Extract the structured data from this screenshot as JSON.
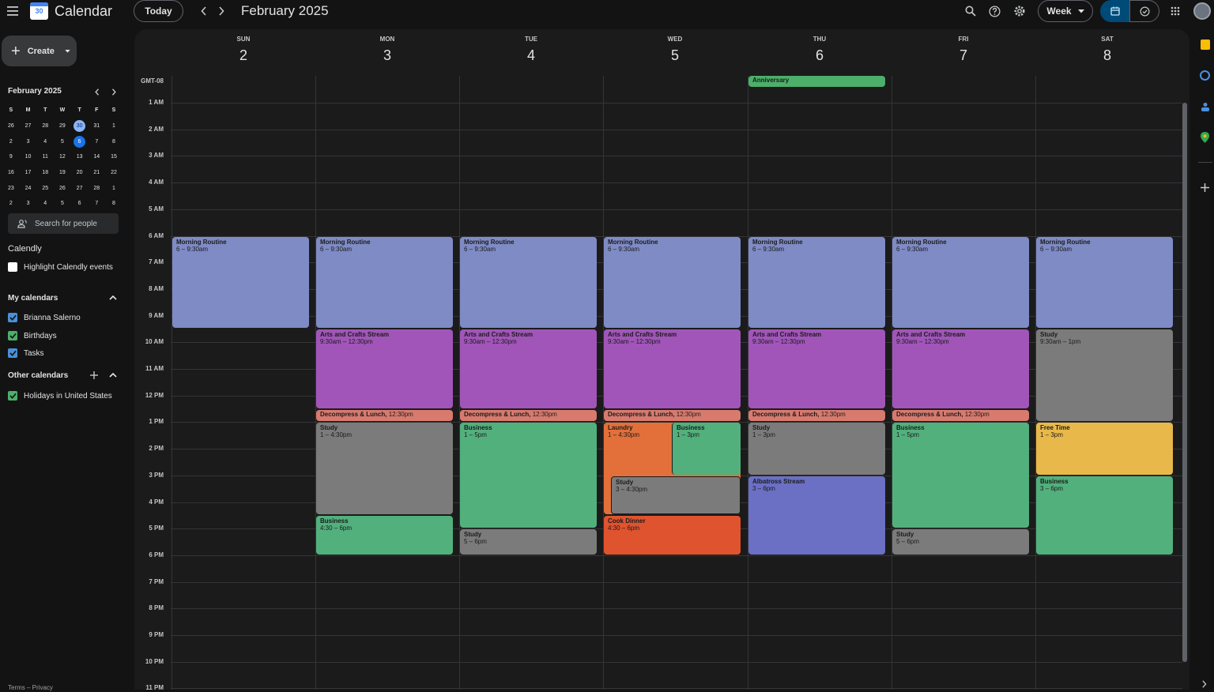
{
  "app": {
    "title": "Calendar",
    "logo_number": "30"
  },
  "header": {
    "today_label": "Today",
    "month_title": "February 2025",
    "view_label": "Week"
  },
  "sidebar": {
    "create_label": "Create",
    "mini_cal": {
      "title": "February 2025",
      "dow": [
        "S",
        "M",
        "T",
        "W",
        "T",
        "F",
        "S"
      ],
      "weeks": [
        [
          "26",
          "27",
          "28",
          "29",
          "30",
          "31",
          "1"
        ],
        [
          "2",
          "3",
          "4",
          "5",
          "6",
          "7",
          "8"
        ],
        [
          "9",
          "10",
          "11",
          "12",
          "13",
          "14",
          "15"
        ],
        [
          "16",
          "17",
          "18",
          "19",
          "20",
          "21",
          "22"
        ],
        [
          "23",
          "24",
          "25",
          "26",
          "27",
          "28",
          "1"
        ],
        [
          "2",
          "3",
          "4",
          "5",
          "6",
          "7",
          "8"
        ]
      ]
    },
    "search_people": "Search for people",
    "calendly": {
      "title": "Calendly",
      "highlight": "Highlight Calendly events"
    },
    "my_calendars": {
      "title": "My calendars",
      "items": [
        "Brianna Salerno",
        "Birthdays",
        "Tasks"
      ]
    },
    "other_calendars": {
      "title": "Other calendars",
      "items": [
        "Holidays in United States"
      ]
    },
    "footer": "Terms – Privacy"
  },
  "week": {
    "timezone": "GMT-08",
    "days": [
      {
        "dow": "SUN",
        "num": "2"
      },
      {
        "dow": "MON",
        "num": "3"
      },
      {
        "dow": "TUE",
        "num": "4"
      },
      {
        "dow": "WED",
        "num": "5"
      },
      {
        "dow": "THU",
        "num": "6"
      },
      {
        "dow": "FRI",
        "num": "7"
      },
      {
        "dow": "SAT",
        "num": "8"
      }
    ],
    "hours": [
      "1 AM",
      "2 AM",
      "3 AM",
      "4 AM",
      "5 AM",
      "6 AM",
      "7 AM",
      "8 AM",
      "9 AM",
      "10 AM",
      "11 AM",
      "12 PM",
      "1 PM",
      "2 PM",
      "3 PM",
      "4 PM",
      "5 PM",
      "6 PM",
      "7 PM",
      "8 PM",
      "9 PM",
      "10 PM",
      "11 PM"
    ],
    "allday": [
      {
        "day": 4,
        "title": "Anniversary",
        "color": "#4caf6a"
      }
    ],
    "events": [
      {
        "day": 0,
        "title": "Morning Routine",
        "time": "6 – 9:30am",
        "start": 6,
        "end": 9.5,
        "color": "#7f8bc5"
      },
      {
        "day": 1,
        "title": "Morning Routine",
        "time": "6 – 9:30am",
        "start": 6,
        "end": 9.5,
        "color": "#7f8bc5"
      },
      {
        "day": 2,
        "title": "Morning Routine",
        "time": "6 – 9:30am",
        "start": 6,
        "end": 9.5,
        "color": "#7f8bc5"
      },
      {
        "day": 3,
        "title": "Morning Routine",
        "time": "6 – 9:30am",
        "start": 6,
        "end": 9.5,
        "color": "#7f8bc5"
      },
      {
        "day": 4,
        "title": "Morning Routine",
        "time": "6 – 9:30am",
        "start": 6,
        "end": 9.5,
        "color": "#7f8bc5"
      },
      {
        "day": 5,
        "title": "Morning Routine",
        "time": "6 – 9:30am",
        "start": 6,
        "end": 9.5,
        "color": "#7f8bc5"
      },
      {
        "day": 6,
        "title": "Morning Routine",
        "time": "6 – 9:30am",
        "start": 6,
        "end": 9.5,
        "color": "#7f8bc5"
      },
      {
        "day": 1,
        "title": "Arts and Crafts Stream",
        "time": "9:30am – 12:30pm",
        "start": 9.5,
        "end": 12.5,
        "color": "#a155b9"
      },
      {
        "day": 2,
        "title": "Arts and Crafts Stream",
        "time": "9:30am – 12:30pm",
        "start": 9.5,
        "end": 12.5,
        "color": "#a155b9"
      },
      {
        "day": 3,
        "title": "Arts and Crafts Stream",
        "time": "9:30am – 12:30pm",
        "start": 9.5,
        "end": 12.5,
        "color": "#a155b9"
      },
      {
        "day": 4,
        "title": "Arts and Crafts Stream",
        "time": "9:30am – 12:30pm",
        "start": 9.5,
        "end": 12.5,
        "color": "#a155b9"
      },
      {
        "day": 5,
        "title": "Arts and Crafts Stream",
        "time": "9:30am – 12:30pm",
        "start": 9.5,
        "end": 12.5,
        "color": "#a155b9"
      },
      {
        "day": 6,
        "title": "Study",
        "time": "9:30am – 1pm",
        "start": 9.5,
        "end": 13,
        "color": "#7b7b7b"
      },
      {
        "day": 1,
        "title": "Decompress & Lunch,",
        "time": " 12:30pm",
        "start": 12.5,
        "end": 13,
        "color": "#d87a6e",
        "inline": true
      },
      {
        "day": 2,
        "title": "Decompress & Lunch,",
        "time": " 12:30pm",
        "start": 12.5,
        "end": 13,
        "color": "#d87a6e",
        "inline": true
      },
      {
        "day": 3,
        "title": "Decompress & Lunch,",
        "time": " 12:30pm",
        "start": 12.5,
        "end": 13,
        "color": "#d87a6e",
        "inline": true
      },
      {
        "day": 4,
        "title": "Decompress & Lunch,",
        "time": " 12:30pm",
        "start": 12.5,
        "end": 13,
        "color": "#d87a6e",
        "inline": true
      },
      {
        "day": 5,
        "title": "Decompress & Lunch,",
        "time": " 12:30pm",
        "start": 12.5,
        "end": 13,
        "color": "#d87a6e",
        "inline": true
      },
      {
        "day": 1,
        "title": "Study",
        "time": "1 – 4:30pm",
        "start": 13,
        "end": 16.5,
        "color": "#7b7b7b"
      },
      {
        "day": 1,
        "title": "Business",
        "time": "4:30 – 6pm",
        "start": 16.5,
        "end": 18,
        "color": "#52b07d"
      },
      {
        "day": 2,
        "title": "Business",
        "time": "1 – 5pm",
        "start": 13,
        "end": 17,
        "color": "#52b07d"
      },
      {
        "day": 2,
        "title": "Study",
        "time": "5 – 6pm",
        "start": 17,
        "end": 18,
        "color": "#7b7b7b"
      },
      {
        "day": 3,
        "title": "Laundry",
        "time": "1 – 4:30pm",
        "start": 13,
        "end": 16.5,
        "color": "#e3703a",
        "col": 0,
        "cols": 2
      },
      {
        "day": 3,
        "title": "Business",
        "time": "1 – 3pm",
        "start": 13,
        "end": 15,
        "color": "#52b07d",
        "col": 1,
        "cols": 2
      },
      {
        "day": 3,
        "title": "Study",
        "time": "3 – 4:30pm",
        "start": 15,
        "end": 16.5,
        "color": "#7b7b7b",
        "offset": true
      },
      {
        "day": 3,
        "title": "Cook Dinner",
        "time": "4:30 – 6pm",
        "start": 16.5,
        "end": 18,
        "color": "#e0532f"
      },
      {
        "day": 4,
        "title": "Study",
        "time": "1 – 3pm",
        "start": 13,
        "end": 15,
        "color": "#7b7b7b"
      },
      {
        "day": 4,
        "title": "Albatross Stream",
        "time": "3 – 6pm",
        "start": 15,
        "end": 18,
        "color": "#6b70c4"
      },
      {
        "day": 5,
        "title": "Business",
        "time": "1 – 5pm",
        "start": 13,
        "end": 17,
        "color": "#52b07d"
      },
      {
        "day": 5,
        "title": "Study",
        "time": "5 – 6pm",
        "start": 17,
        "end": 18,
        "color": "#7b7b7b"
      },
      {
        "day": 6,
        "title": "Free Time",
        "time": "1 – 3pm",
        "start": 13,
        "end": 15,
        "color": "#e8b84a"
      },
      {
        "day": 6,
        "title": "Business",
        "time": "3 – 6pm",
        "start": 15,
        "end": 18,
        "color": "#52b07d"
      }
    ]
  },
  "colors": {
    "selected_day": "#1a73e8",
    "today_ring": "#8ab4f8",
    "checkbox_blue": "#4a90d9",
    "checkbox_green": "#4caf6a"
  }
}
